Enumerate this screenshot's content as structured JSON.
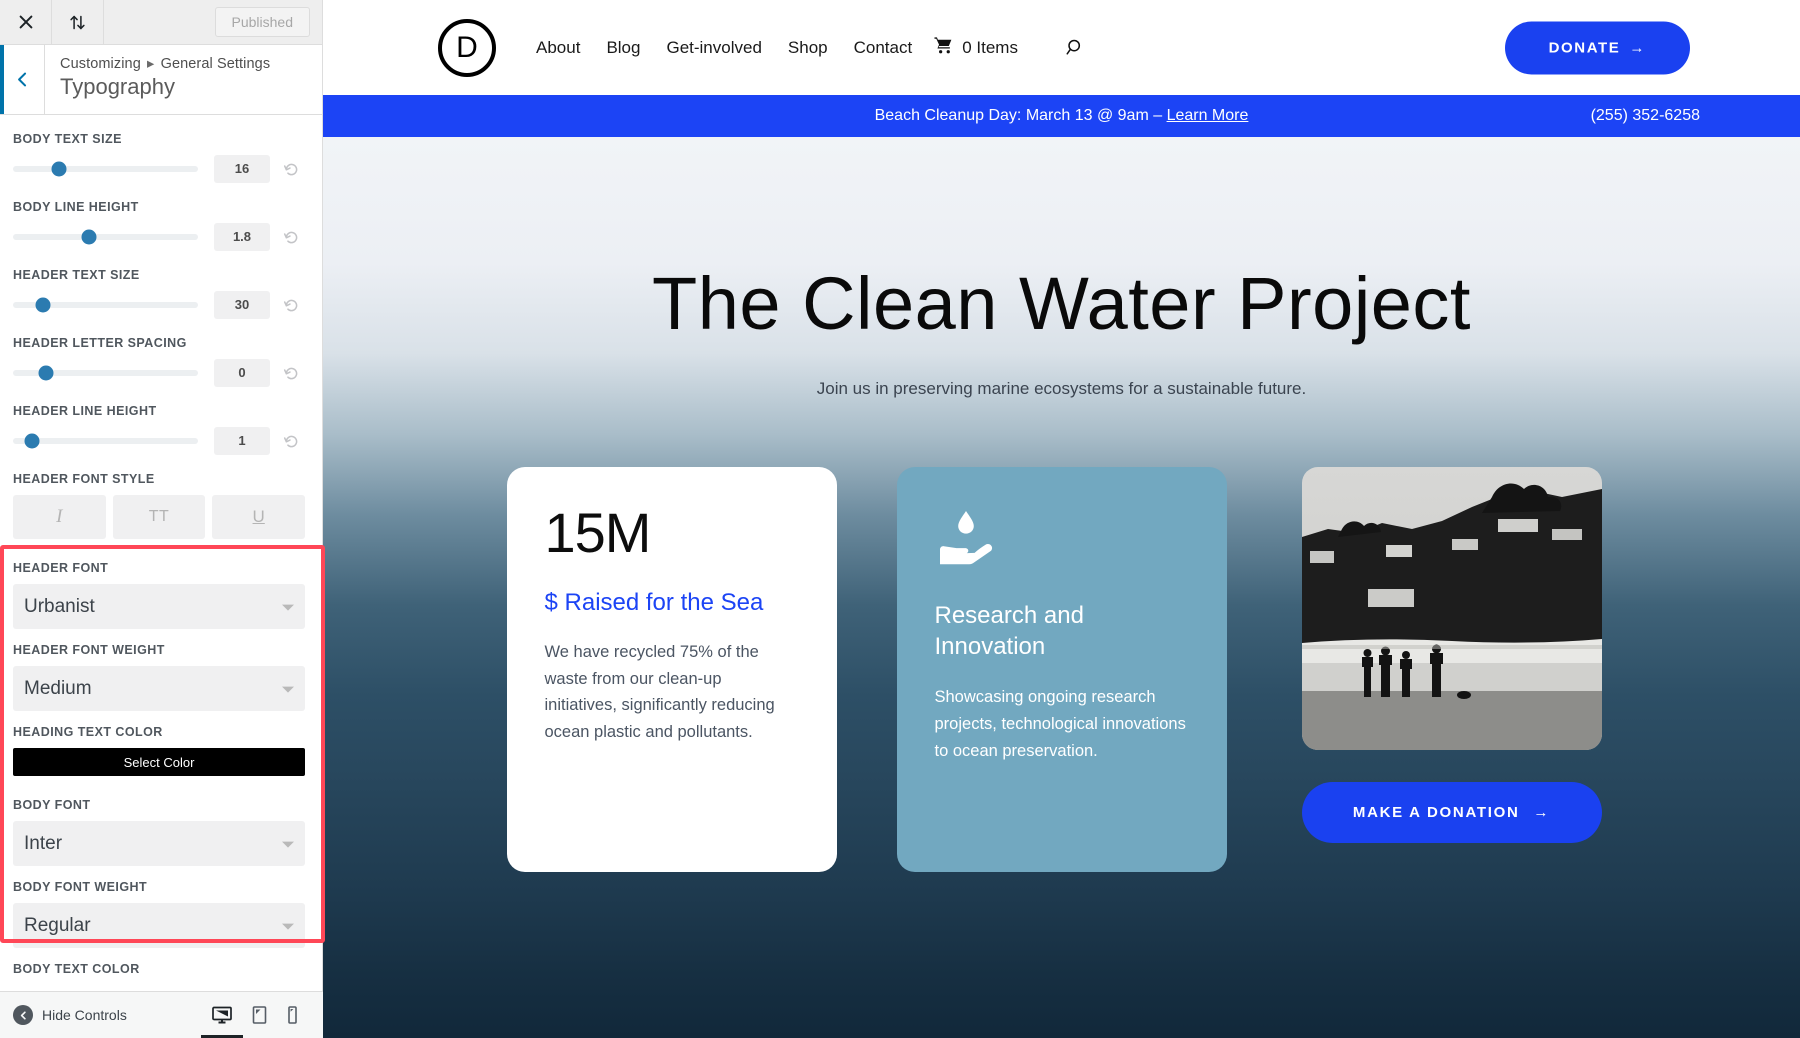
{
  "customizer": {
    "topbar": {
      "close_icon": "close-icon",
      "updown_icon": "updown-arrows-icon",
      "published_label": "Published"
    },
    "header": {
      "back_icon": "chevron-left-icon",
      "breadcrumb_root": "Customizing",
      "breadcrumb_separator": "▸",
      "breadcrumb_section": "General Settings",
      "panel_title": "Typography"
    },
    "sliders": [
      {
        "label": "BODY TEXT SIZE",
        "value": "16",
        "knob_pct": 25
      },
      {
        "label": "BODY LINE HEIGHT",
        "value": "1.8",
        "knob_pct": 41
      },
      {
        "label": "HEADER TEXT SIZE",
        "value": "30",
        "knob_pct": 16
      },
      {
        "label": "HEADER LETTER SPACING",
        "value": "0",
        "knob_pct": 18
      },
      {
        "label": "HEADER LINE HEIGHT",
        "value": "1",
        "knob_pct": 10
      }
    ],
    "font_style": {
      "label": "HEADER FONT STYLE",
      "buttons": [
        {
          "name": "italic-button",
          "glyph": "I"
        },
        {
          "name": "uppercase-button",
          "glyph": "TT"
        },
        {
          "name": "underline-button",
          "glyph": "U"
        }
      ]
    },
    "header_font": {
      "label": "HEADER FONT",
      "value": "Urbanist"
    },
    "header_font_weight": {
      "label": "HEADER FONT WEIGHT",
      "value": "Medium"
    },
    "heading_text_color": {
      "label": "HEADING TEXT COLOR",
      "button_label": "Select Color",
      "swatch": "#000000"
    },
    "body_font": {
      "label": "BODY FONT",
      "value": "Inter"
    },
    "body_font_weight": {
      "label": "BODY FONT WEIGHT",
      "value": "Regular"
    },
    "body_text_color": {
      "label": "BODY TEXT COLOR"
    },
    "highlight_color": "#ff4757",
    "footer": {
      "hide_controls_label": "Hide Controls",
      "devices": [
        {
          "name": "device-desktop",
          "active": true
        },
        {
          "name": "device-tablet",
          "active": false
        },
        {
          "name": "device-mobile",
          "active": false
        }
      ]
    }
  },
  "site": {
    "logo_letter": "D",
    "nav": [
      {
        "label": "About"
      },
      {
        "label": "Blog"
      },
      {
        "label": "Get-involved"
      },
      {
        "label": "Shop"
      },
      {
        "label": "Contact"
      }
    ],
    "cart_label": "0 Items",
    "search_icon": "search-icon",
    "donate_button": {
      "label": "DONATE",
      "arrow": "→",
      "color": "#1a41f0"
    },
    "announcement": {
      "text": "Beach Cleanup Day: March 13 @ 9am – ",
      "link_label": "Learn More",
      "phone": "(255) 352-6258",
      "bar_color": "#1c44f5"
    },
    "hero": {
      "title": "The Clean Water Project",
      "subtitle": "Join us in preserving marine ecosystems for a sustainable future."
    },
    "cards": [
      {
        "type": "stat",
        "stat": "15M",
        "tagline": "$ Raised for the Sea",
        "body": "We have recycled 75% of the waste from our clean-up initiatives, significantly reducing ocean plastic and pollutants."
      },
      {
        "type": "feature",
        "icon": "water-drop-in-hand-icon",
        "title": "Research and Innovation",
        "body": "Showcasing ongoing research projects, technological innovations to ocean preservation.",
        "bg_color": "#72a8c0"
      },
      {
        "type": "photo",
        "image_alt": "people-walking-on-beach-photo",
        "button_label": "MAKE A DONATION",
        "button_arrow": "→"
      }
    ]
  }
}
